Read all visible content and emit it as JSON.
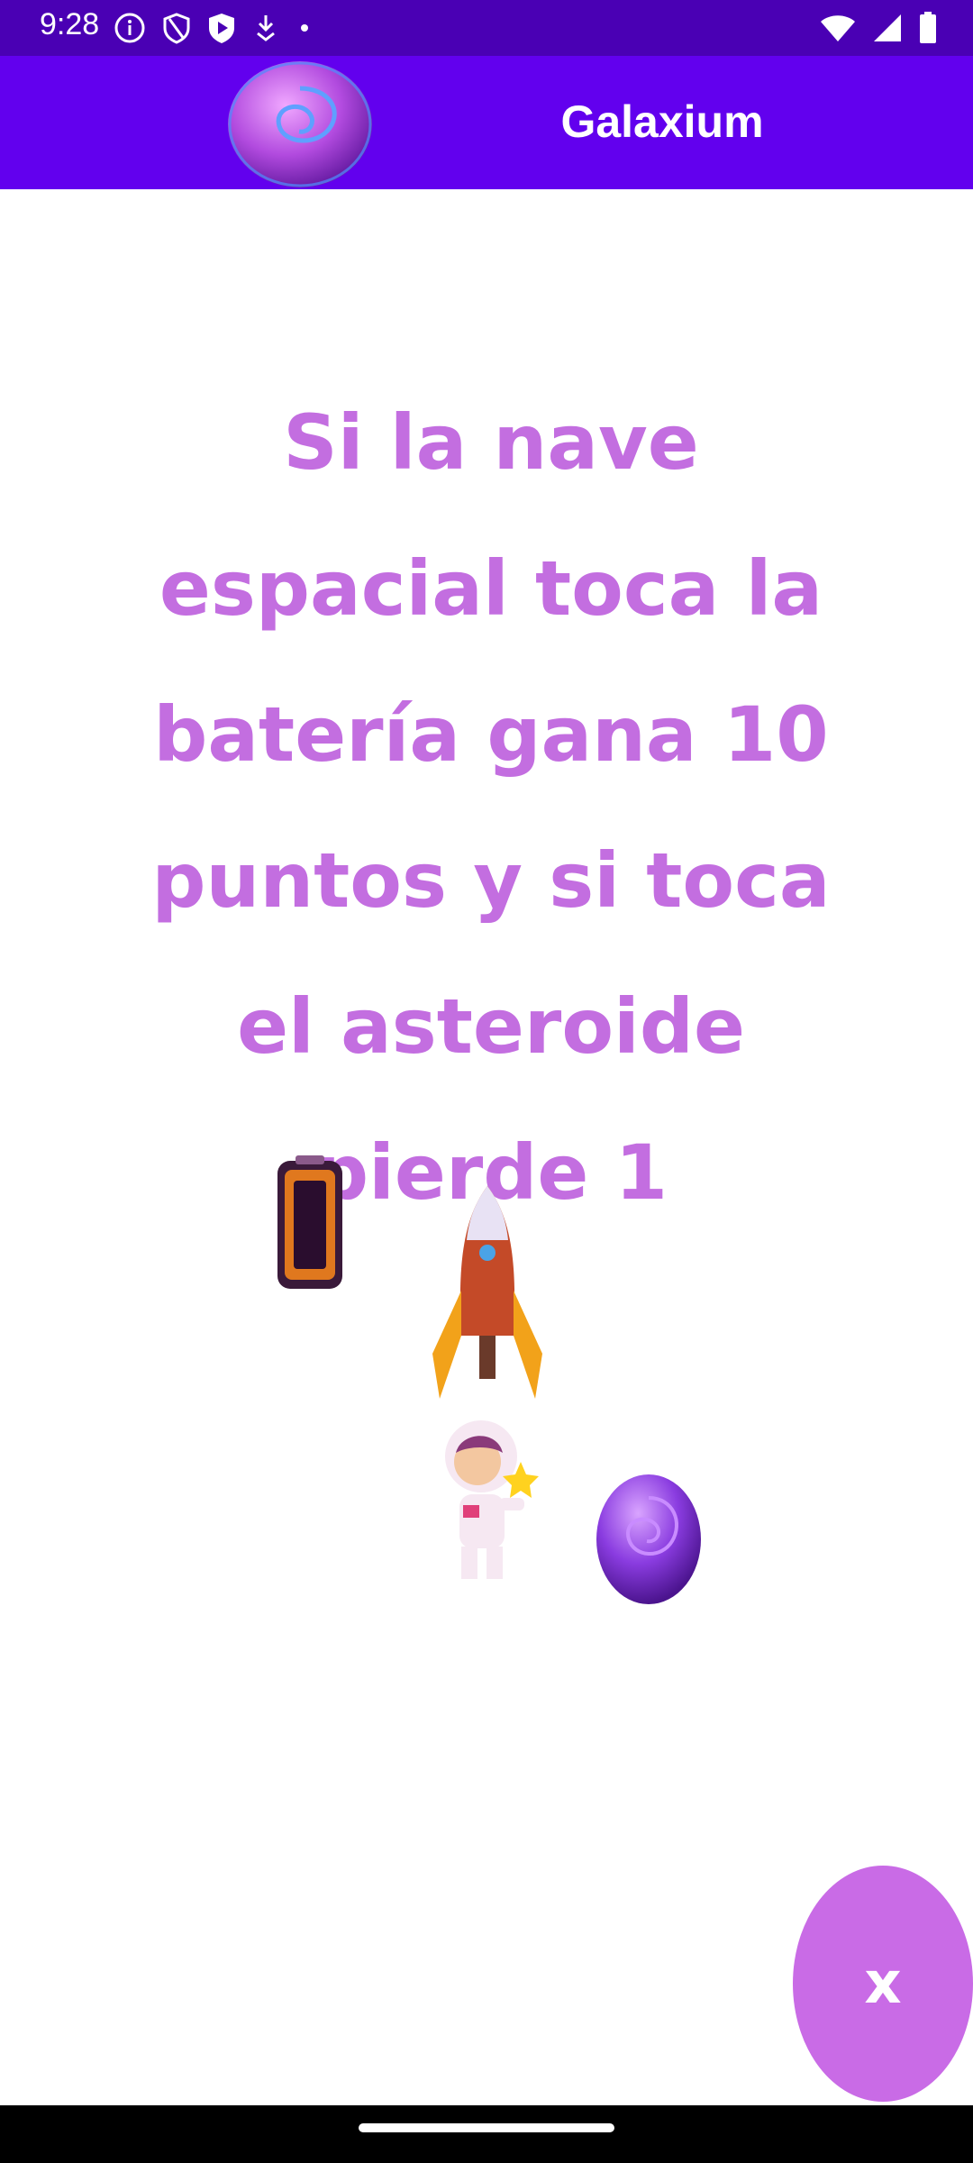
{
  "status_bar": {
    "time": "9:28",
    "icons": [
      "info-icon",
      "shield-icon",
      "play-protect-icon",
      "download-icon",
      "dot-icon",
      "wifi-icon",
      "signal-icon",
      "battery-icon"
    ]
  },
  "app_bar": {
    "title": "Galaxium",
    "logo_icon": "planet-logo"
  },
  "instructions": {
    "text": "Si la nave espacial toca la batería gana 10 puntos y si toca el asteroide pierde 1"
  },
  "sprites": [
    "battery-sprite",
    "rocket-sprite",
    "astronaut-sprite",
    "asteroid-sprite"
  ],
  "close_button": {
    "label": "x"
  },
  "colors": {
    "status_bar": "#4a00b4",
    "app_bar": "#6200ee",
    "accent_text": "#c36ee0",
    "close_button": "#c96be6"
  }
}
